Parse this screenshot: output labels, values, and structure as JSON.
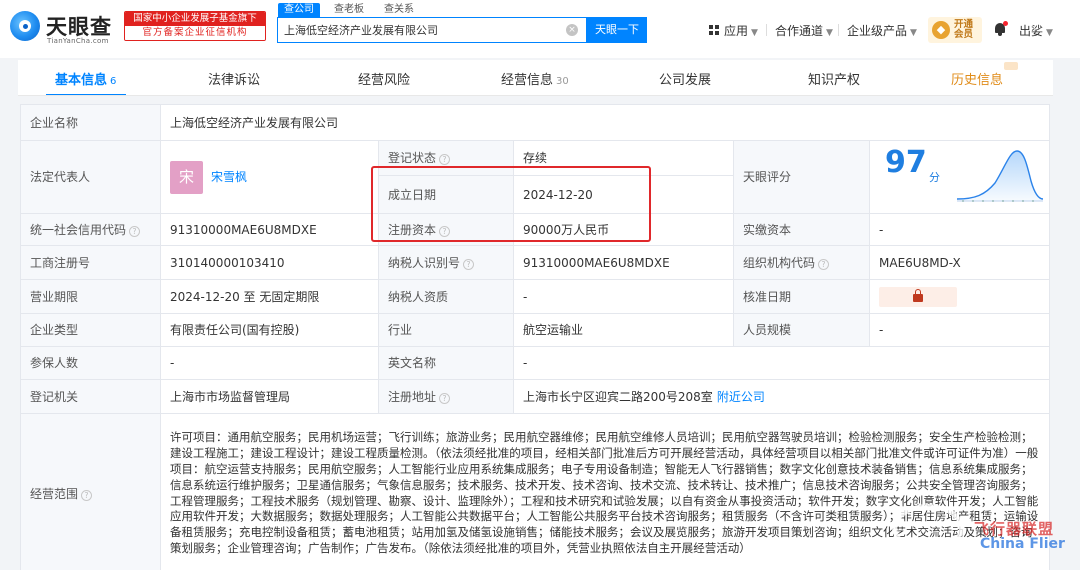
{
  "brand": {
    "name": "天眼查",
    "domain": "TianYanCha.com",
    "badge_line1": "国家中小企业发展子基金旗下",
    "badge_line2": "官方备案企业征信机构"
  },
  "search": {
    "tabs": [
      "查公司",
      "查老板",
      "查关系"
    ],
    "value": "上海低空经济产业发展有限公司",
    "button": "天眼一下"
  },
  "header_nav": {
    "apps": "应用",
    "partners": "合作通道",
    "enterprise": "企业级产品",
    "vip_line1": "开通",
    "vip_line2": "会员",
    "user": "出娑"
  },
  "tabs": [
    {
      "label": "基本信息",
      "count": "6"
    },
    {
      "label": "法律诉讼",
      "count": ""
    },
    {
      "label": "经营风险",
      "count": ""
    },
    {
      "label": "经营信息",
      "count": "30"
    },
    {
      "label": "公司发展",
      "count": ""
    },
    {
      "label": "知识产权",
      "count": ""
    },
    {
      "label": "历史信息",
      "count": ""
    }
  ],
  "labels": {
    "company_name": "企业名称",
    "legal_rep": "法定代表人",
    "reg_status": "登记状态",
    "est_date": "成立日期",
    "reg_capital": "注册资本",
    "tyc_score": "天眼评分",
    "credit_code": "统一社会信用代码",
    "paid_capital": "实缴资本",
    "biz_reg_no": "工商注册号",
    "taxpayer_id": "纳税人识别号",
    "org_code": "组织机构代码",
    "biz_term": "营业期限",
    "taxpayer_qual": "纳税人资质",
    "approval_date": "核准日期",
    "company_type": "企业类型",
    "industry": "行业",
    "staff_size": "人员规模",
    "insured": "参保人数",
    "english_name": "英文名称",
    "reg_authority": "登记机关",
    "reg_address": "注册地址",
    "scope": "经营范围"
  },
  "values": {
    "company_name": "上海低空经济产业发展有限公司",
    "legal_rep_avatar": "宋",
    "legal_rep": "宋雪枫",
    "reg_status": "存续",
    "est_date": "2024-12-20",
    "reg_capital": "90000万人民币",
    "tyc_score": "97",
    "tyc_score_unit": "分",
    "credit_code": "91310000MAE6U8MDXE",
    "paid_capital": "-",
    "biz_reg_no": "310140000103410",
    "taxpayer_id": "91310000MAE6U8MDXE",
    "org_code": "MAE6U8MD-X",
    "biz_term": "2024-12-20 至 无固定期限",
    "taxpayer_qual": "-",
    "company_type": "有限责任公司(国有控股)",
    "industry": "航空运输业",
    "staff_size": "-",
    "insured": "-",
    "english_name": "-",
    "reg_authority": "上海市市场监督管理局",
    "reg_address": "上海市长宁区迎宾二路200号208室",
    "nearby_link": "附近公司",
    "scope": "许可项目：通用航空服务；民用机场运营；飞行训练；旅游业务；民用航空器维修；民用航空维修人员培训；民用航空器驾驶员培训；检验检测服务；安全生产检验检测；建设工程施工；建设工程设计；建设工程质量检测。（依法须经批准的项目，经相关部门批准后方可开展经营活动，具体经营项目以相关部门批准文件或许可证件为准）一般项目：航空运营支持服务；民用航空服务；人工智能行业应用系统集成服务；电子专用设备制造；智能无人飞行器销售；数字文化创意技术装备销售；信息系统集成服务；信息系统运行维护服务；卫星通信服务；气象信息服务；技术服务、技术开发、技术咨询、技术交流、技术转让、技术推广；信息技术咨询服务；公共安全管理咨询服务；工程管理服务；工程技术服务（规划管理、勘察、设计、监理除外）；工程和技术研究和试验发展；以自有资金从事投资活动；软件开发；数字文化创意软件开发；人工智能应用软件开发；大数据服务；数据处理服务；人工智能公共数据平台；人工智能公共服务平台技术咨询服务；租赁服务（不含许可类租赁服务）；非居住房地产租赁；运输设备租赁服务；充电控制设备租赁；蓄电池租赁；站用加氢及储氢设施销售；储能技术服务；会议及展览服务；旅游开发项目策划咨询；组织文化艺术交流活动及策划；咨询策划服务；企业管理咨询；广告制作；广告发布。（除依法须经批准的项目外，凭营业执照依法自主开展经营活动）"
  },
  "watermark": {
    "line1": "飞行器联盟",
    "line2": "China Flier"
  },
  "colors": {
    "brand_blue": "#0084ff",
    "highlight_red": "#e0282b",
    "status_green": "#3aa96d",
    "history_orange": "#e08c1a"
  }
}
